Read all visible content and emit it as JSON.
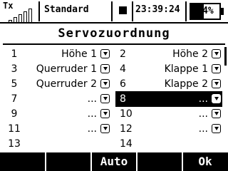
{
  "status_bar": {
    "tx_label": "Tx",
    "tx_signal_bars": 5,
    "tx_signal_active": 0,
    "model_name": "Standard",
    "clock": "23:39:24",
    "battery_text": "44%",
    "battery_level_percent": 44
  },
  "screen": {
    "title": "Servozuordnung"
  },
  "rows": [
    {
      "left": {
        "num": "1",
        "value": "Höhe 1"
      },
      "right": {
        "num": "2",
        "value": "Höhe 2"
      }
    },
    {
      "left": {
        "num": "3",
        "value": "Querruder 1"
      },
      "right": {
        "num": "4",
        "value": "Klappe 1"
      }
    },
    {
      "left": {
        "num": "5",
        "value": "Querruder 2"
      },
      "right": {
        "num": "6",
        "value": "Klappe 2"
      }
    },
    {
      "left": {
        "num": "7",
        "value": "..."
      },
      "right": {
        "num": "8",
        "value": "...",
        "selected": true
      }
    },
    {
      "left": {
        "num": "9",
        "value": "..."
      },
      "right": {
        "num": "10",
        "value": "..."
      }
    },
    {
      "left": {
        "num": "11",
        "value": "..."
      },
      "right": {
        "num": "12",
        "value": "..."
      }
    },
    {
      "left": {
        "num": "13",
        "value": ""
      },
      "right": {
        "num": "14",
        "value": ""
      }
    }
  ],
  "softkeys": [
    "",
    "",
    "Auto",
    "",
    "Ok"
  ],
  "colors": {
    "foreground": "#000000",
    "background": "#ffffff"
  },
  "icons": {
    "dropdown": "dropdown-arrow-icon"
  }
}
